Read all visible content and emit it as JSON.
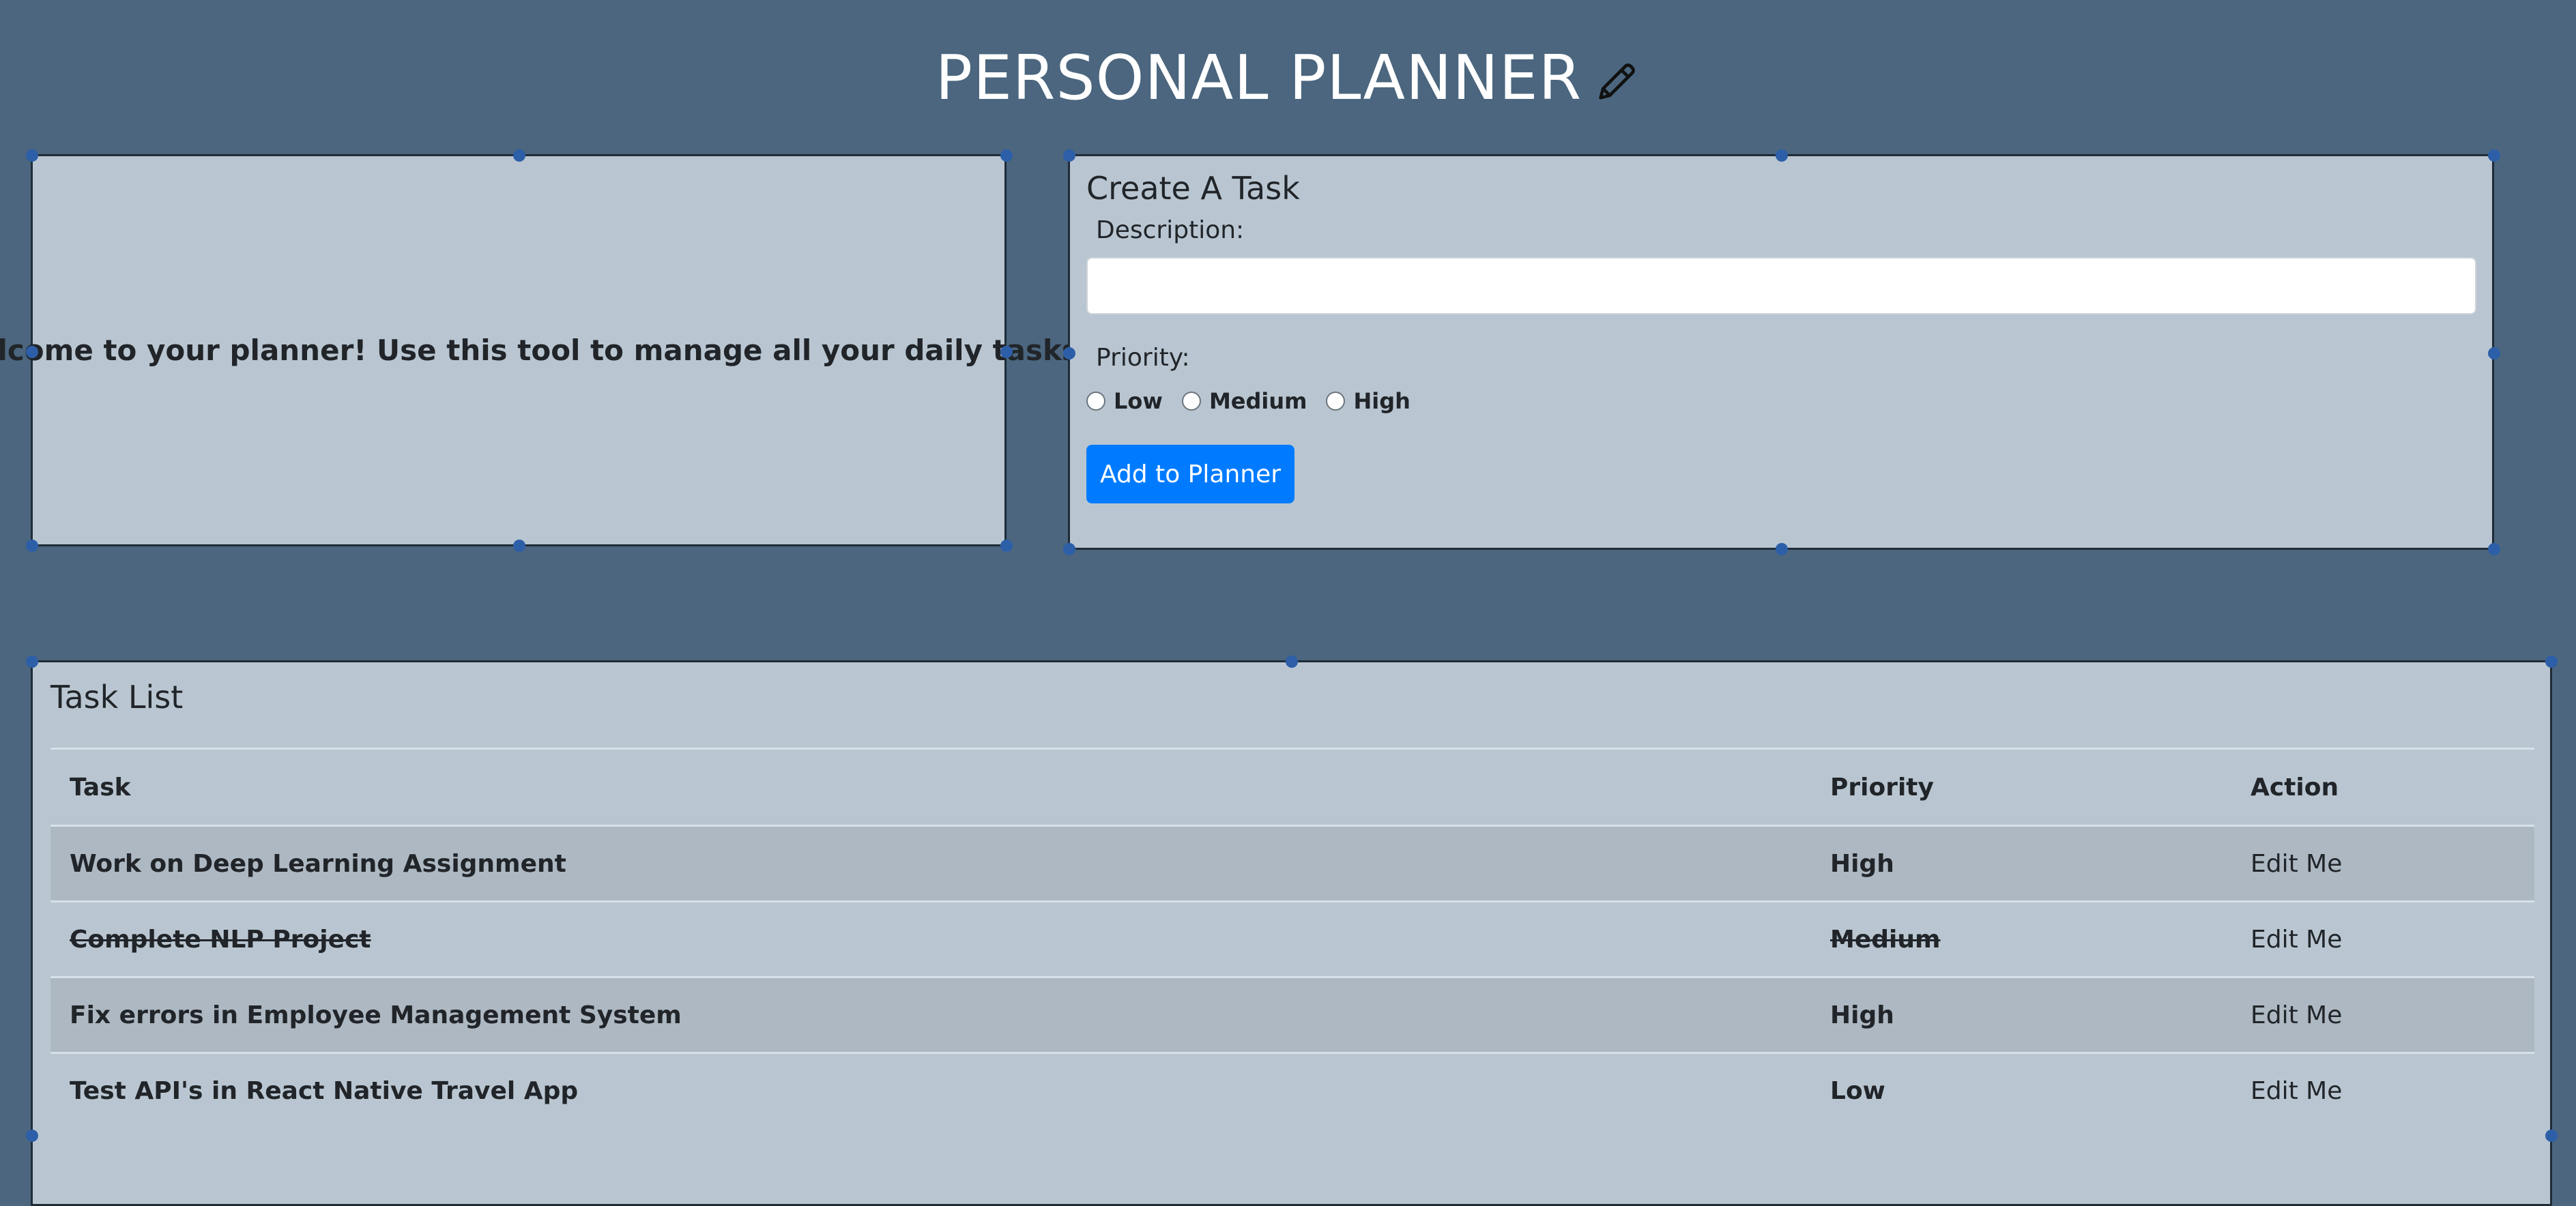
{
  "header": {
    "title": "PERSONAL PLANNER",
    "icon": "pencil-icon"
  },
  "welcome": {
    "text": "Welcome to your planner! Use this tool to manage all your daily tasks."
  },
  "create_task": {
    "heading": "Create A Task",
    "description_label": "Description:",
    "description_value": "",
    "priority_label": "Priority:",
    "priority_options": [
      "Low",
      "Medium",
      "High"
    ],
    "submit_label": "Add to Planner"
  },
  "task_list": {
    "heading": "Task List",
    "columns": [
      "Task",
      "Priority",
      "Action"
    ],
    "rows": [
      {
        "task": "Work on Deep Learning Assignment",
        "priority": "High",
        "action": "Edit Me",
        "completed": false
      },
      {
        "task": "Complete NLP Project",
        "priority": "Medium",
        "action": "Edit Me",
        "completed": true
      },
      {
        "task": "Fix errors in Employee Management System",
        "priority": "High",
        "action": "Edit Me",
        "completed": false
      },
      {
        "task": "Test API's in React Native Travel App",
        "priority": "Low",
        "action": "Edit Me",
        "completed": false
      }
    ]
  },
  "colors": {
    "background": "#4b667e",
    "panel": "#b9c6d1",
    "accent": "#007bff"
  }
}
